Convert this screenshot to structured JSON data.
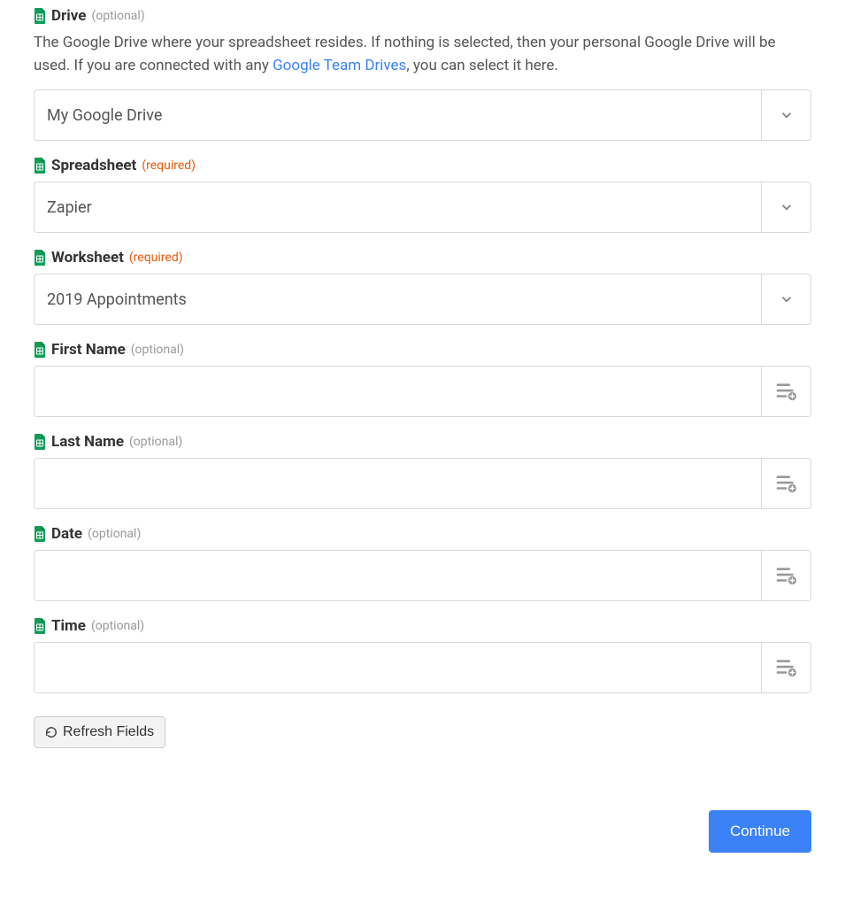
{
  "fields": {
    "drive": {
      "label": "Drive",
      "badge": "(optional)",
      "help_pre": "The Google Drive where your spreadsheet resides. If nothing is selected, then your personal Google Drive will be used. If you are connected with any ",
      "help_link": "Google Team Drives",
      "help_post": ", you can select it here.",
      "value": "My Google Drive"
    },
    "spreadsheet": {
      "label": "Spreadsheet",
      "badge": "(required)",
      "value": "Zapier"
    },
    "worksheet": {
      "label": "Worksheet",
      "badge": "(required)",
      "value": "2019 Appointments"
    },
    "first_name": {
      "label": "First Name",
      "badge": "(optional)",
      "value": ""
    },
    "last_name": {
      "label": "Last Name",
      "badge": "(optional)",
      "value": ""
    },
    "date": {
      "label": "Date",
      "badge": "(optional)",
      "value": ""
    },
    "time": {
      "label": "Time",
      "badge": "(optional)",
      "value": ""
    }
  },
  "buttons": {
    "refresh": "Refresh Fields",
    "continue": "Continue"
  }
}
